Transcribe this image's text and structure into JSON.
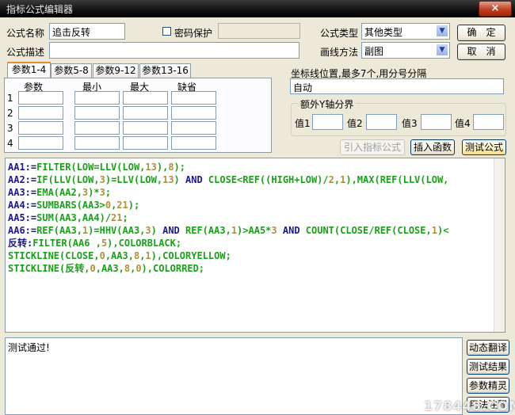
{
  "window": {
    "title": "指标公式编辑器",
    "close_glyph": "×"
  },
  "form": {
    "name_label": "公式名称",
    "name_value": "追击反转",
    "password_label": "密码保护",
    "desc_label": "公式描述",
    "desc_value": "",
    "type_label": "公式类型",
    "type_value": "其他类型",
    "draw_label": "画线方法",
    "draw_value": "副图"
  },
  "buttons": {
    "ok": "确　定",
    "cancel": "取　消",
    "import": "引入指标公式",
    "insert_func": "插入函数",
    "test": "测试公式"
  },
  "tabs": [
    {
      "label": "参数1-4",
      "active": true
    },
    {
      "label": "参数5-8"
    },
    {
      "label": "参数9-12"
    },
    {
      "label": "参数13-16"
    }
  ],
  "param_grid": {
    "headers": [
      "参数",
      "最小",
      "最大",
      "缺省"
    ],
    "rows": [
      "1",
      "2",
      "3",
      "4"
    ]
  },
  "axis": {
    "label": "坐标线位置,最多7个,用分号分隔",
    "value": "自动"
  },
  "extra_y": {
    "title": "额外Y轴分界",
    "labels": [
      "值1",
      "值2",
      "值3",
      "值4"
    ]
  },
  "code_lines": [
    [
      [
        "AA1:=",
        "#1a1a8c"
      ],
      [
        "FILTER(LOW=LLV(LOW,",
        "#1aa01a"
      ],
      [
        "13",
        "#b0903a"
      ],
      [
        "),",
        "#1aa01a"
      ],
      [
        "8",
        "#b0903a"
      ],
      [
        ");",
        "#1aa01a"
      ]
    ],
    [
      [
        "AA2:=",
        "#1a1a8c"
      ],
      [
        "IF(LLV(LOW,",
        "#1aa01a"
      ],
      [
        "3",
        "#b0903a"
      ],
      [
        ")=LLV(LOW,",
        "#1aa01a"
      ],
      [
        "13",
        "#b0903a"
      ],
      [
        ") ",
        "#1aa01a"
      ],
      [
        "AND",
        "#1a1a8c"
      ],
      [
        " CLOSE<REF((HIGH+LOW)/",
        "#1aa01a"
      ],
      [
        "2",
        "#b0903a"
      ],
      [
        ",",
        "#1aa01a"
      ],
      [
        "1",
        "#b0903a"
      ],
      [
        "),MAX(REF(LLV(LOW,",
        "#1aa01a"
      ]
    ],
    [
      [
        "AA3:=",
        "#1a1a8c"
      ],
      [
        "EMA(AA2,",
        "#1aa01a"
      ],
      [
        "3",
        "#b0903a"
      ],
      [
        ")*",
        "#1aa01a"
      ],
      [
        "3",
        "#b0903a"
      ],
      [
        ";",
        "#1aa01a"
      ]
    ],
    [
      [
        "AA4:=",
        "#1a1a8c"
      ],
      [
        "SUMBARS(AA3>",
        "#1aa01a"
      ],
      [
        "0",
        "#b0903a"
      ],
      [
        ",",
        "#1aa01a"
      ],
      [
        "21",
        "#b0903a"
      ],
      [
        ");",
        "#1aa01a"
      ]
    ],
    [
      [
        "AA5:=",
        "#1a1a8c"
      ],
      [
        "SUM(AA3,AA4)/",
        "#1aa01a"
      ],
      [
        "21",
        "#b0903a"
      ],
      [
        ";",
        "#1aa01a"
      ]
    ],
    [
      [
        "AA6:=",
        "#1a1a8c"
      ],
      [
        "REF(AA3,",
        "#1aa01a"
      ],
      [
        "1",
        "#b0903a"
      ],
      [
        ")=HHV(AA3,",
        "#1aa01a"
      ],
      [
        "3",
        "#b0903a"
      ],
      [
        ") ",
        "#1aa01a"
      ],
      [
        "AND",
        "#1a1a8c"
      ],
      [
        " REF(AA3,",
        "#1aa01a"
      ],
      [
        "1",
        "#b0903a"
      ],
      [
        ")>AA5*",
        "#1aa01a"
      ],
      [
        "3",
        "#b0903a"
      ],
      [
        " ",
        "#1aa01a"
      ],
      [
        "AND",
        "#1a1a8c"
      ],
      [
        " COUNT(CLOSE/REF(CLOSE,",
        "#1aa01a"
      ],
      [
        "1",
        "#b0903a"
      ],
      [
        ")<",
        "#1aa01a"
      ]
    ],
    [
      [
        "反转:",
        "#1a1a8c"
      ],
      [
        "FILTER(AA6 ,",
        "#1aa01a"
      ],
      [
        "5",
        "#b0903a"
      ],
      [
        "),COLORBLACK;",
        "#1aa01a"
      ]
    ],
    [
      [
        "STICKLINE(CLOSE,",
        "#1aa01a"
      ],
      [
        "0",
        "#b0903a"
      ],
      [
        ",AA3,",
        "#1aa01a"
      ],
      [
        "8",
        "#b0903a"
      ],
      [
        ",",
        "#1aa01a"
      ],
      [
        "1",
        "#b0903a"
      ],
      [
        "),COLORYELLOW;",
        "#1aa01a"
      ]
    ],
    [
      [
        "STICKLINE(反转,",
        "#1aa01a"
      ],
      [
        "0",
        "#b0903a"
      ],
      [
        ",AA3,",
        "#1aa01a"
      ],
      [
        "8",
        "#b0903a"
      ],
      [
        ",",
        "#1aa01a"
      ],
      [
        "0",
        "#b0903a"
      ],
      [
        "),COLORRED;",
        "#1aa01a"
      ]
    ]
  ],
  "output": {
    "text": "测试通过!"
  },
  "side_buttons": [
    "动态翻译",
    "测试结果",
    "参数精灵",
    "用法注释"
  ],
  "watermark": "178448.COM"
}
